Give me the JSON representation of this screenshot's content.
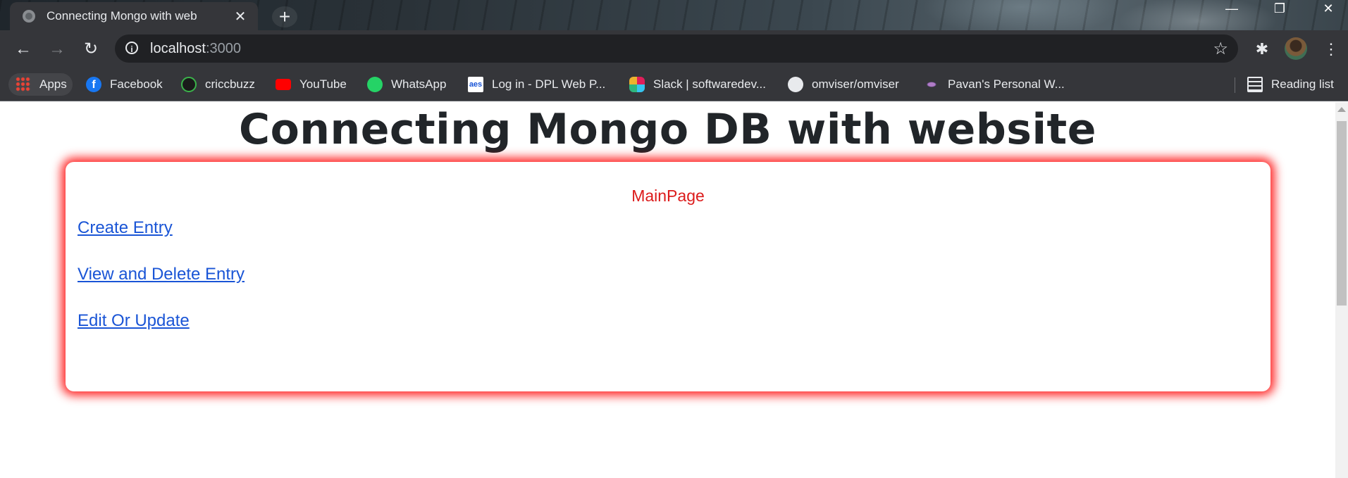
{
  "browser": {
    "tab_title": "Connecting Mongo with web",
    "new_tab_label": "+",
    "url_host": "localhost",
    "url_port": ":3000",
    "reading_list": "Reading list"
  },
  "bookmarks": [
    {
      "label": "Apps"
    },
    {
      "label": "Facebook"
    },
    {
      "label": "criccbuzz"
    },
    {
      "label": "YouTube"
    },
    {
      "label": "WhatsApp"
    },
    {
      "label": "Log in - DPL Web P..."
    },
    {
      "label": "Slack | softwaredev..."
    },
    {
      "label": "omviser/omviser"
    },
    {
      "label": "Pavan's Personal W..."
    }
  ],
  "page": {
    "heading": "Connecting Mongo DB with website",
    "card_title": "MainPage",
    "links": [
      {
        "label": "Create Entry"
      },
      {
        "label": "View and Delete Entry"
      },
      {
        "label": "Edit Or Update"
      }
    ]
  },
  "colors": {
    "link": "#1a55d6",
    "card_title": "#dc1b1b",
    "card_glow": "#ff0000"
  }
}
